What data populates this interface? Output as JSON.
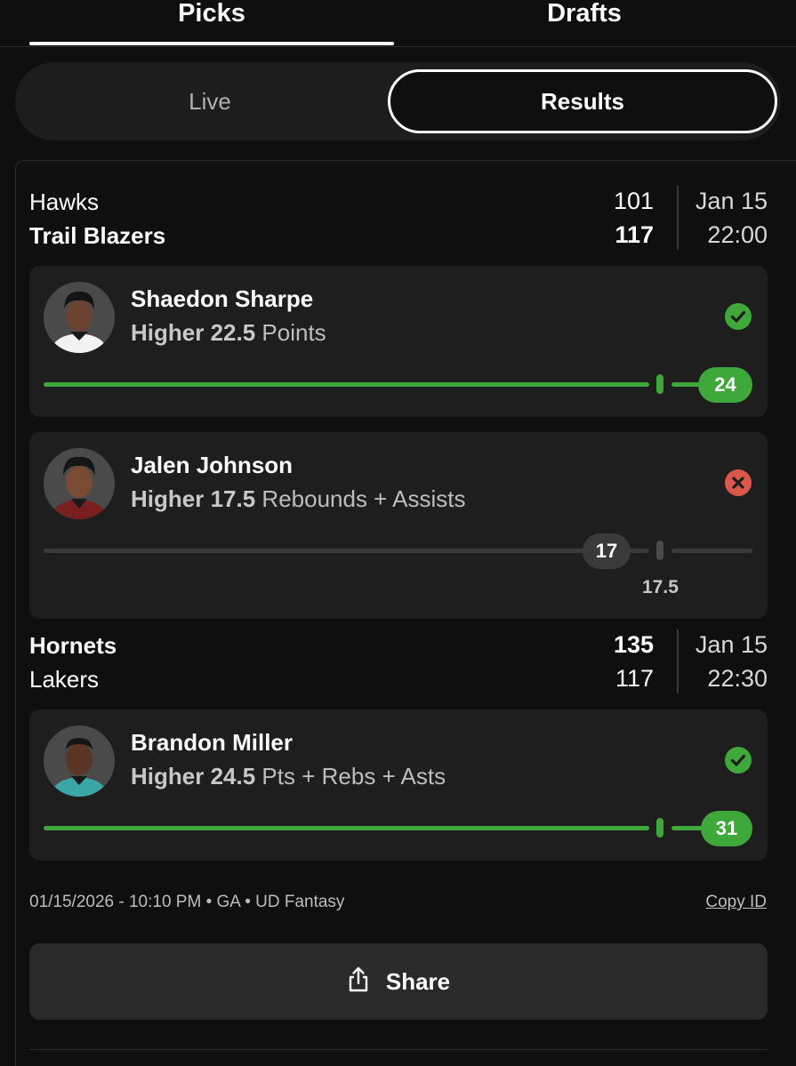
{
  "tabs": {
    "picks": "Picks",
    "drafts": "Drafts"
  },
  "segment": {
    "live": "Live",
    "results": "Results"
  },
  "games": [
    {
      "teams": [
        {
          "name": "Hawks",
          "score": "101"
        },
        {
          "name": "Trail Blazers",
          "score": "117"
        }
      ],
      "date": "Jan 15",
      "time": "22:00"
    },
    {
      "teams": [
        {
          "name": "Hornets",
          "score": "135"
        },
        {
          "name": "Lakers",
          "score": "117"
        }
      ],
      "date": "Jan 15",
      "time": "22:30"
    }
  ],
  "picks": [
    {
      "player": "Shaedon Sharpe",
      "direction": "Higher",
      "line": "22.5",
      "stat": "Points",
      "result": "24",
      "status": "won"
    },
    {
      "player": "Jalen Johnson",
      "direction": "Higher",
      "line": "17.5",
      "stat": "Rebounds + Assists",
      "result": "17",
      "line_label": "17.5",
      "status": "lost"
    },
    {
      "player": "Brandon Miller",
      "direction": "Higher",
      "line": "24.5",
      "stat": "Pts + Rebs + Asts",
      "result": "31",
      "status": "won"
    }
  ],
  "footer": {
    "meta": "01/15/2026 - 10:10 PM • GA • UD Fantasy",
    "copy_id": "Copy ID",
    "share": "Share"
  },
  "colors": {
    "win_green": "#3ea83a",
    "loss_red": "#d9574b",
    "background": "#0f0f0f",
    "card": "#1e1e1e"
  },
  "icons": {
    "won": "check-circle-icon",
    "lost": "x-circle-icon",
    "share": "share-icon"
  }
}
